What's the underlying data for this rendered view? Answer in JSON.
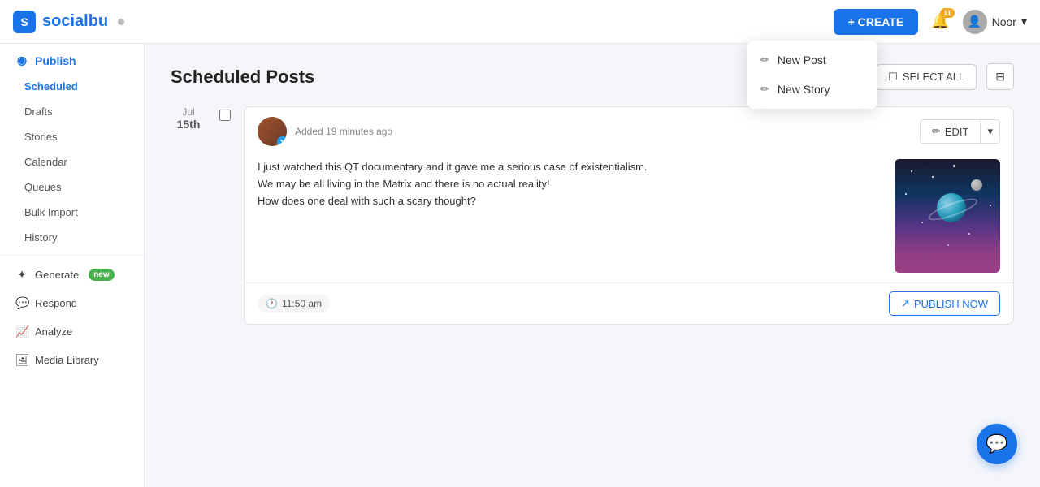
{
  "topnav": {
    "logo_text": "socialbu",
    "logo_dot": "●",
    "create_label": "+ CREATE",
    "notif_count": "11",
    "user_name": "Noor"
  },
  "dropdown": {
    "new_post_label": "New Post",
    "new_story_label": "New Story",
    "new_post_icon": "✏",
    "new_story_icon": "✏"
  },
  "sidebar": {
    "publish_label": "Publish",
    "scheduled_label": "Scheduled",
    "drafts_label": "Drafts",
    "stories_label": "Stories",
    "calendar_label": "Calendar",
    "queues_label": "Queues",
    "bulk_import_label": "Bulk Import",
    "history_label": "History",
    "generate_label": "Generate",
    "generate_badge": "new",
    "respond_label": "Respond",
    "analyze_label": "Analyze",
    "media_library_label": "Media Library"
  },
  "main": {
    "page_title": "Scheduled Posts",
    "select_all_label": "SELECT ALL",
    "post_date_month": "Jul",
    "post_date_day": "15th",
    "post_added_time": "Added 19 minutes ago",
    "post_text_line1": "I just watched this QT documentary and it gave me a serious case of existentialism.",
    "post_text_line2": "We may be all living in the Matrix and there is no actual reality!",
    "post_text_line3": "How does one deal with such a scary thought?",
    "post_time": "11:50 am",
    "edit_label": "EDIT",
    "publish_now_label": "PUBLISH NOW"
  },
  "chat_fab": {
    "icon": "💬"
  }
}
